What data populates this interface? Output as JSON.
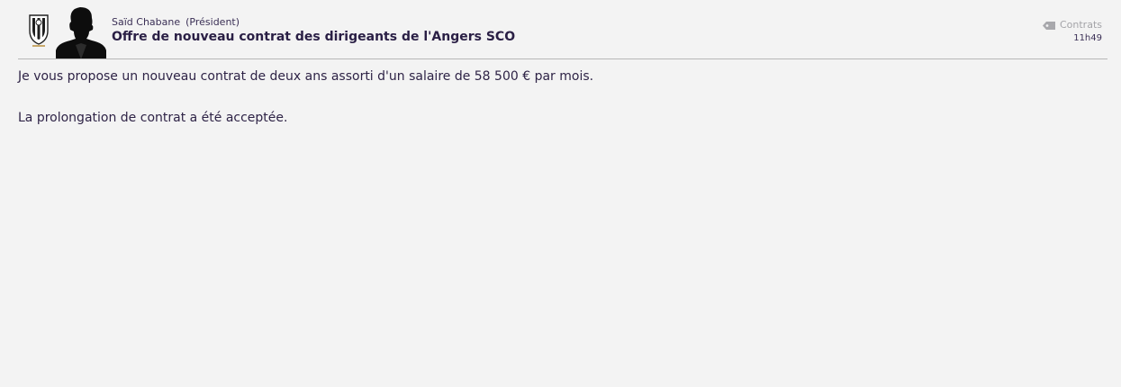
{
  "message": {
    "sender_name": "Saïd Chabane",
    "sender_role": "(Président)",
    "subject": "Offre de nouveau contrat des dirigeants de l'Angers SCO",
    "category": "Contrats",
    "time": "11h49",
    "category_icon": "tag-icon",
    "club_badge_icon": "angers-sco-badge-icon",
    "avatar_icon": "silhouette-avatar-icon",
    "paragraphs": [
      "Je vous propose un nouveau contrat de deux ans assorti d'un salaire de 58 500 € par mois.",
      "La prolongation de contrat a été acceptée."
    ]
  }
}
